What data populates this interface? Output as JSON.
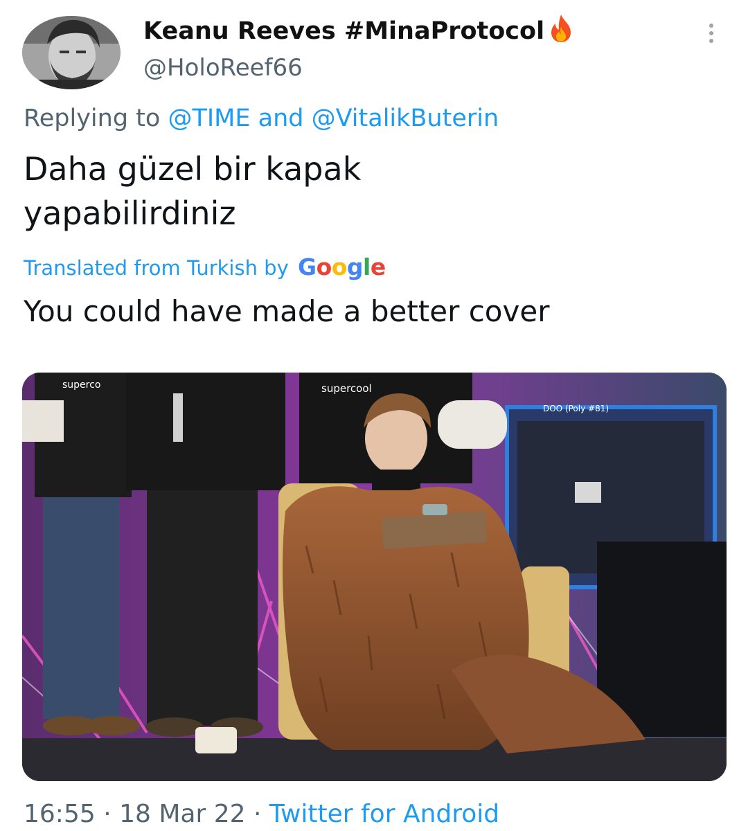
{
  "author": {
    "name": "Keanu Reeves #MinaProtocol",
    "handle": "@HoloReef66",
    "name_emoji": "fire-icon"
  },
  "reply": {
    "prefix": "Replying to",
    "mention_1": "@TIME",
    "joiner": "and",
    "mention_2": "@VitalikButerin"
  },
  "tweet": {
    "text_line_1": "Daha güzel bir kapak",
    "text_line_2": "yapabilirdiniz"
  },
  "translation": {
    "label": "Translated from Turkish by",
    "provider": "Google",
    "text": "You could have made a better cover"
  },
  "media": {
    "shirt_text_1": "superco",
    "shirt_text_2": "supercool",
    "screen_text": "DOO (Poly #81)"
  },
  "meta": {
    "time": "16:55",
    "separator": "·",
    "date": "18 Mar 22",
    "source": "Twitter for Android"
  },
  "colors": {
    "link": "#1d9bf0",
    "secondary_text": "#536471",
    "primary_text": "#0f1419"
  }
}
